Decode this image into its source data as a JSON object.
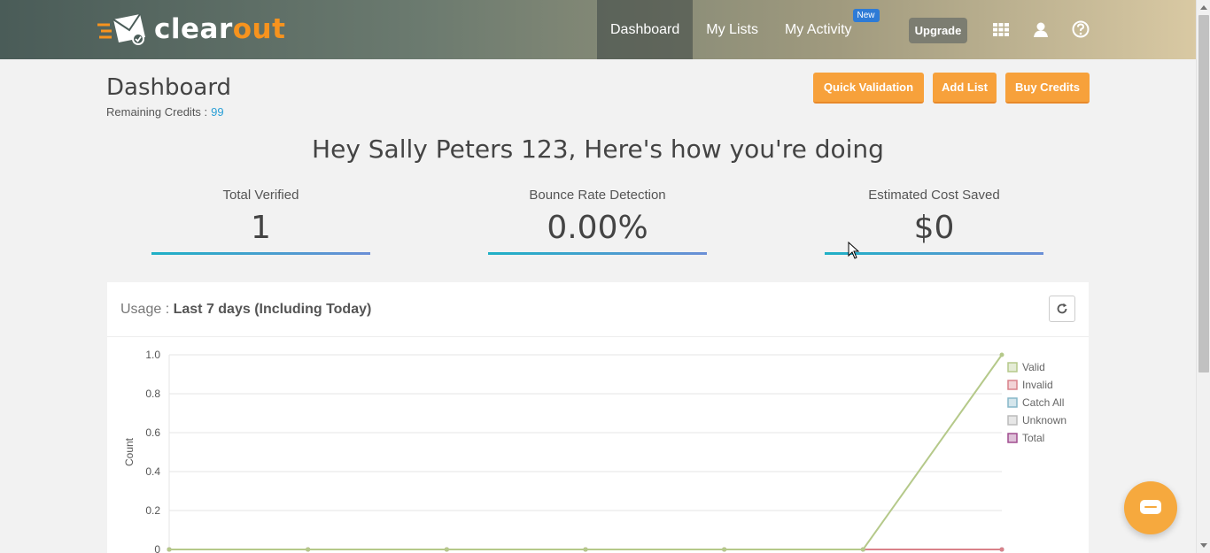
{
  "header": {
    "logo_prefix": "clear",
    "logo_highlight": "out",
    "nav": [
      {
        "label": "Dashboard",
        "active": true
      },
      {
        "label": "My Lists",
        "active": false
      },
      {
        "label": "My Activity",
        "active": false,
        "badge": "New"
      }
    ],
    "upgrade_label": "Upgrade",
    "icons": [
      "apps-grid-icon",
      "user-icon",
      "help-icon"
    ]
  },
  "page": {
    "title": "Dashboard",
    "credits_label": "Remaining Credits :",
    "credits_value": "99",
    "buttons": {
      "quick_validation": "Quick Validation",
      "add_list": "Add List",
      "buy_credits": "Buy Credits"
    },
    "greeting": "Hey Sally Peters 123, Here's how you're doing"
  },
  "stats": [
    {
      "label": "Total Verified",
      "value": "1"
    },
    {
      "label": "Bounce Rate Detection",
      "value": "0.00%"
    },
    {
      "label": "Estimated Cost Saved",
      "value": "$0"
    }
  ],
  "usage": {
    "title_prefix": "Usage :",
    "title_range": "Last 7 days (Including Today)"
  },
  "colors": {
    "accent": "#f7a13b",
    "link": "#2a9fd6",
    "valid": "#b5c98a",
    "invalid": "#d9828a",
    "catch_all": "#86b7c9",
    "unknown": "#bbbbbb",
    "total": "#a14d8f"
  },
  "chart_data": {
    "type": "line",
    "ylabel": "Count",
    "xlabel": "",
    "ylim": [
      0,
      1.0
    ],
    "yticks": [
      "1.0",
      "0.8",
      "0.6",
      "0.4",
      "0.2",
      "0"
    ],
    "grid": true,
    "legend_placement": "right",
    "x": [
      1,
      2,
      3,
      4,
      5,
      6,
      7
    ],
    "series": [
      {
        "name": "Valid",
        "values": [
          0,
          0,
          0,
          0,
          0,
          0,
          1
        ],
        "color": "#b5c98a"
      },
      {
        "name": "Invalid",
        "values": [
          0,
          0,
          0,
          0,
          0,
          0,
          0
        ],
        "color": "#d9828a"
      },
      {
        "name": "Catch All",
        "values": [
          0,
          0,
          0,
          0,
          0,
          0,
          0
        ],
        "color": "#86b7c9"
      },
      {
        "name": "Unknown",
        "values": [
          0,
          0,
          0,
          0,
          0,
          0,
          0
        ],
        "color": "#bbbbbb"
      },
      {
        "name": "Total",
        "values": [
          0,
          0,
          0,
          0,
          0,
          0,
          0
        ],
        "color": "#a14d8f"
      }
    ]
  }
}
